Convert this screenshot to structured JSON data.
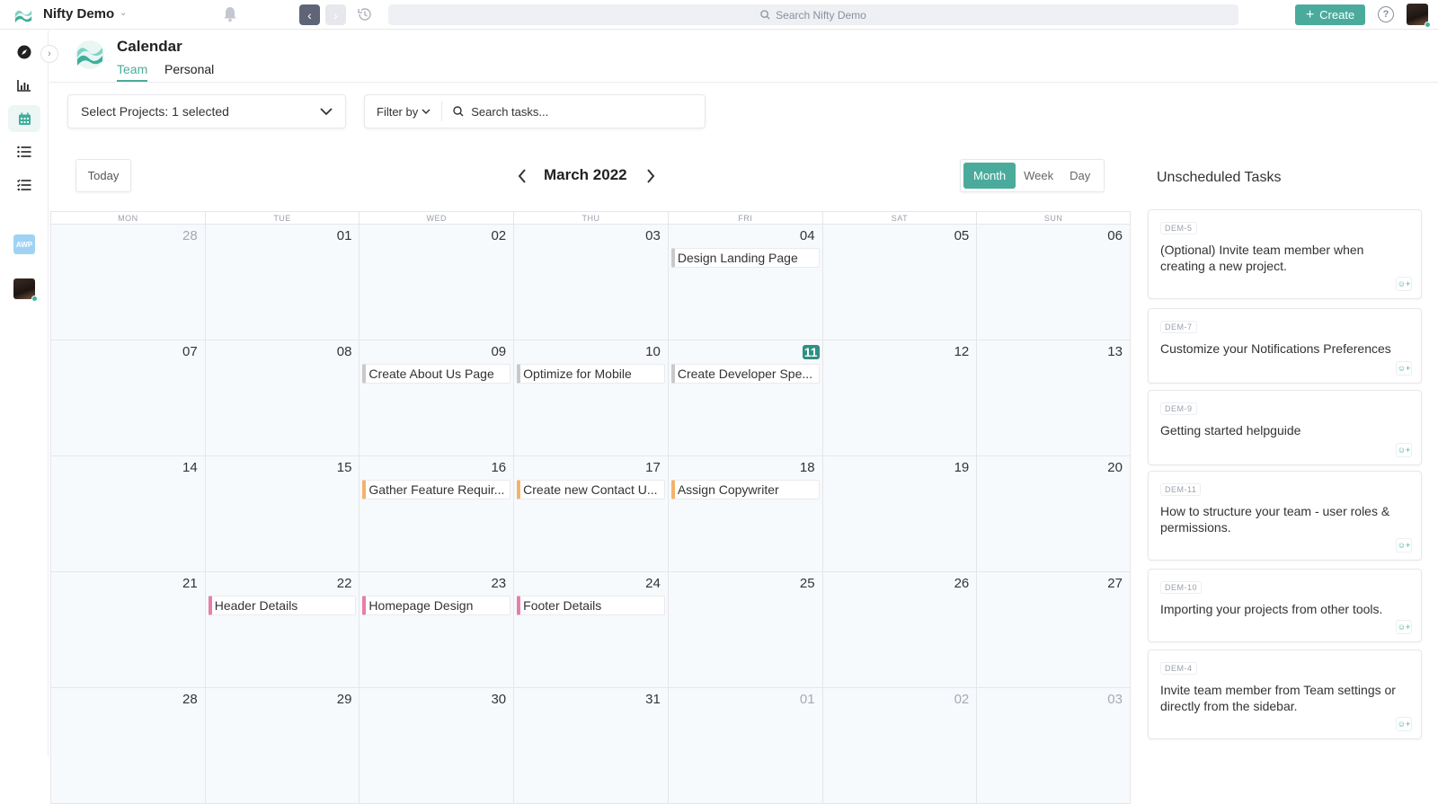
{
  "topbar": {
    "workspace_name": "Nifty Demo",
    "search_placeholder": "Search Nifty Demo",
    "create_label": "Create",
    "accent": "#4aab9c"
  },
  "sidebar": {
    "items": [
      {
        "name": "explore",
        "icon": "compass-icon"
      },
      {
        "name": "reports",
        "icon": "bar-chart-icon"
      },
      {
        "name": "calendar",
        "icon": "calendar-icon",
        "active": true
      },
      {
        "name": "list",
        "icon": "list-icon"
      },
      {
        "name": "tasks",
        "icon": "checklist-icon"
      }
    ],
    "project_badge": "AWP"
  },
  "header": {
    "title": "Calendar",
    "tabs": [
      {
        "label": "Team",
        "active": true
      },
      {
        "label": "Personal",
        "active": false
      }
    ]
  },
  "filters": {
    "projects_label": "Select Projects: 1 selected",
    "filter_by_label": "Filter by",
    "search_placeholder": "Search tasks..."
  },
  "calendar": {
    "today_label": "Today",
    "month_label": "March 2022",
    "views": [
      {
        "label": "Month",
        "active": true
      },
      {
        "label": "Week",
        "active": false
      },
      {
        "label": "Day",
        "active": false
      }
    ],
    "days_of_week": [
      "MON",
      "TUE",
      "WED",
      "THU",
      "FRI",
      "SAT",
      "SUN"
    ],
    "weeks": [
      [
        {
          "num": "28",
          "other": true
        },
        {
          "num": "01"
        },
        {
          "num": "02"
        },
        {
          "num": "03"
        },
        {
          "num": "04",
          "event": {
            "title": "Design Landing Page",
            "color": "#c9c9cc"
          }
        },
        {
          "num": "05"
        },
        {
          "num": "06"
        }
      ],
      [
        {
          "num": "07"
        },
        {
          "num": "08"
        },
        {
          "num": "09",
          "event": {
            "title": "Create About Us Page",
            "color": "#c9c9cc"
          }
        },
        {
          "num": "10",
          "event": {
            "title": "Optimize for Mobile",
            "color": "#c9c9cc"
          }
        },
        {
          "num": "11",
          "today": true,
          "event": {
            "title": "Create Developer Spe...",
            "color": "#c9c9cc"
          }
        },
        {
          "num": "12"
        },
        {
          "num": "13"
        }
      ],
      [
        {
          "num": "14"
        },
        {
          "num": "15"
        },
        {
          "num": "16",
          "event": {
            "title": "Gather Feature Requir...",
            "color": "#f2b36b"
          }
        },
        {
          "num": "17",
          "event": {
            "title": "Create new Contact U...",
            "color": "#f2b36b"
          }
        },
        {
          "num": "18",
          "event": {
            "title": "Assign Copywriter",
            "color": "#f2b36b"
          }
        },
        {
          "num": "19"
        },
        {
          "num": "20"
        }
      ],
      [
        {
          "num": "21"
        },
        {
          "num": "22",
          "event": {
            "title": "Header Details",
            "color": "#e77fa9"
          }
        },
        {
          "num": "23",
          "event": {
            "title": "Homepage Design",
            "color": "#e77fa9"
          }
        },
        {
          "num": "24",
          "event": {
            "title": "Footer Details",
            "color": "#e77fa9"
          }
        },
        {
          "num": "25"
        },
        {
          "num": "26"
        },
        {
          "num": "27"
        }
      ],
      [
        {
          "num": "28"
        },
        {
          "num": "29"
        },
        {
          "num": "30"
        },
        {
          "num": "31"
        },
        {
          "num": "01",
          "other": true
        },
        {
          "num": "02",
          "other": true
        },
        {
          "num": "03",
          "other": true
        }
      ]
    ]
  },
  "unscheduled": {
    "title": "Unscheduled Tasks",
    "tasks": [
      {
        "id": "DEM-5",
        "text": "(Optional) Invite team member when creating a new project."
      },
      {
        "id": "DEM-7",
        "text": "Customize your Notifications Preferences"
      },
      {
        "id": "DEM-9",
        "text": "Getting started helpguide"
      },
      {
        "id": "DEM-11",
        "text": "How to structure your team - user roles & permissions."
      },
      {
        "id": "DEM-10",
        "text": "Importing your projects from other tools."
      },
      {
        "id": "DEM-4",
        "text": "Invite team member from Team settings or directly from the sidebar."
      }
    ]
  }
}
